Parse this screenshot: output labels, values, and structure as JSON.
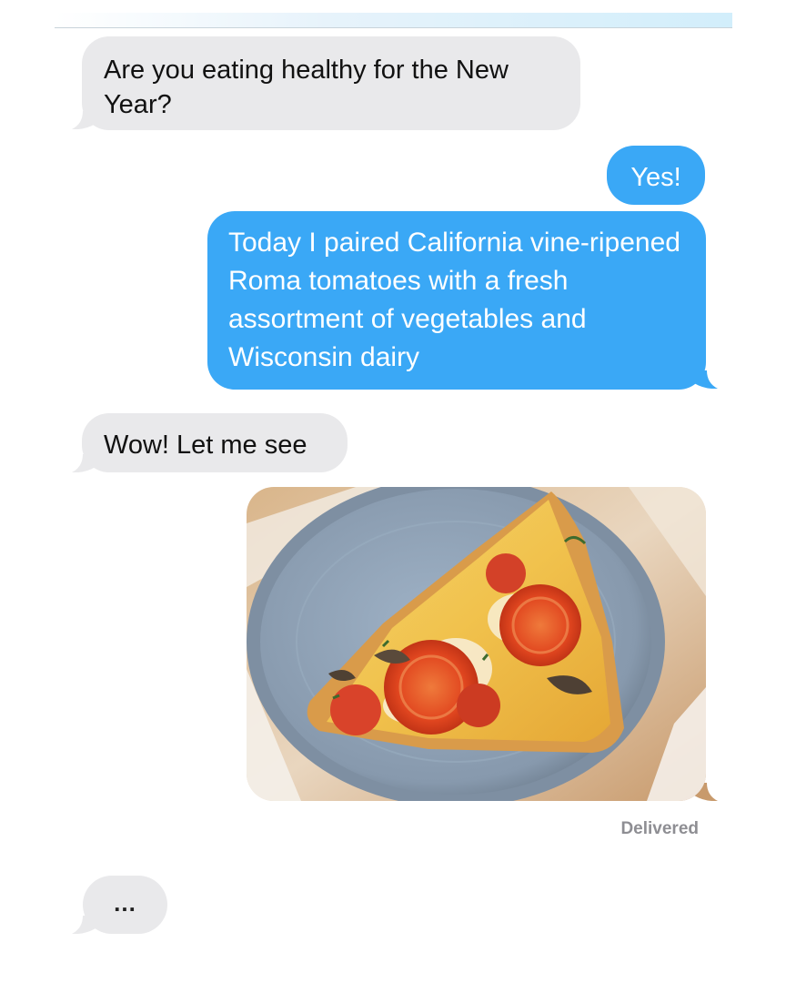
{
  "conversation": {
    "messages": [
      {
        "sender": "them",
        "text": "Are you eating healthy for the New Year?"
      },
      {
        "sender": "me",
        "text": "Yes!"
      },
      {
        "sender": "me",
        "text": "Today I paired California vine-ripened Roma tomatoes with a fresh assortment of vegetables and Wisconsin dairy"
      },
      {
        "sender": "them",
        "text": "Wow! Let me see"
      },
      {
        "sender": "me",
        "type": "photo",
        "subject": "pizza-slice-photo"
      }
    ],
    "status": "Delivered",
    "typing_indicator": "..."
  },
  "colors": {
    "incoming_bubble": "#e9e9eb",
    "outgoing_bubble": "#3aa8f6",
    "status_text": "#8e8e93"
  }
}
